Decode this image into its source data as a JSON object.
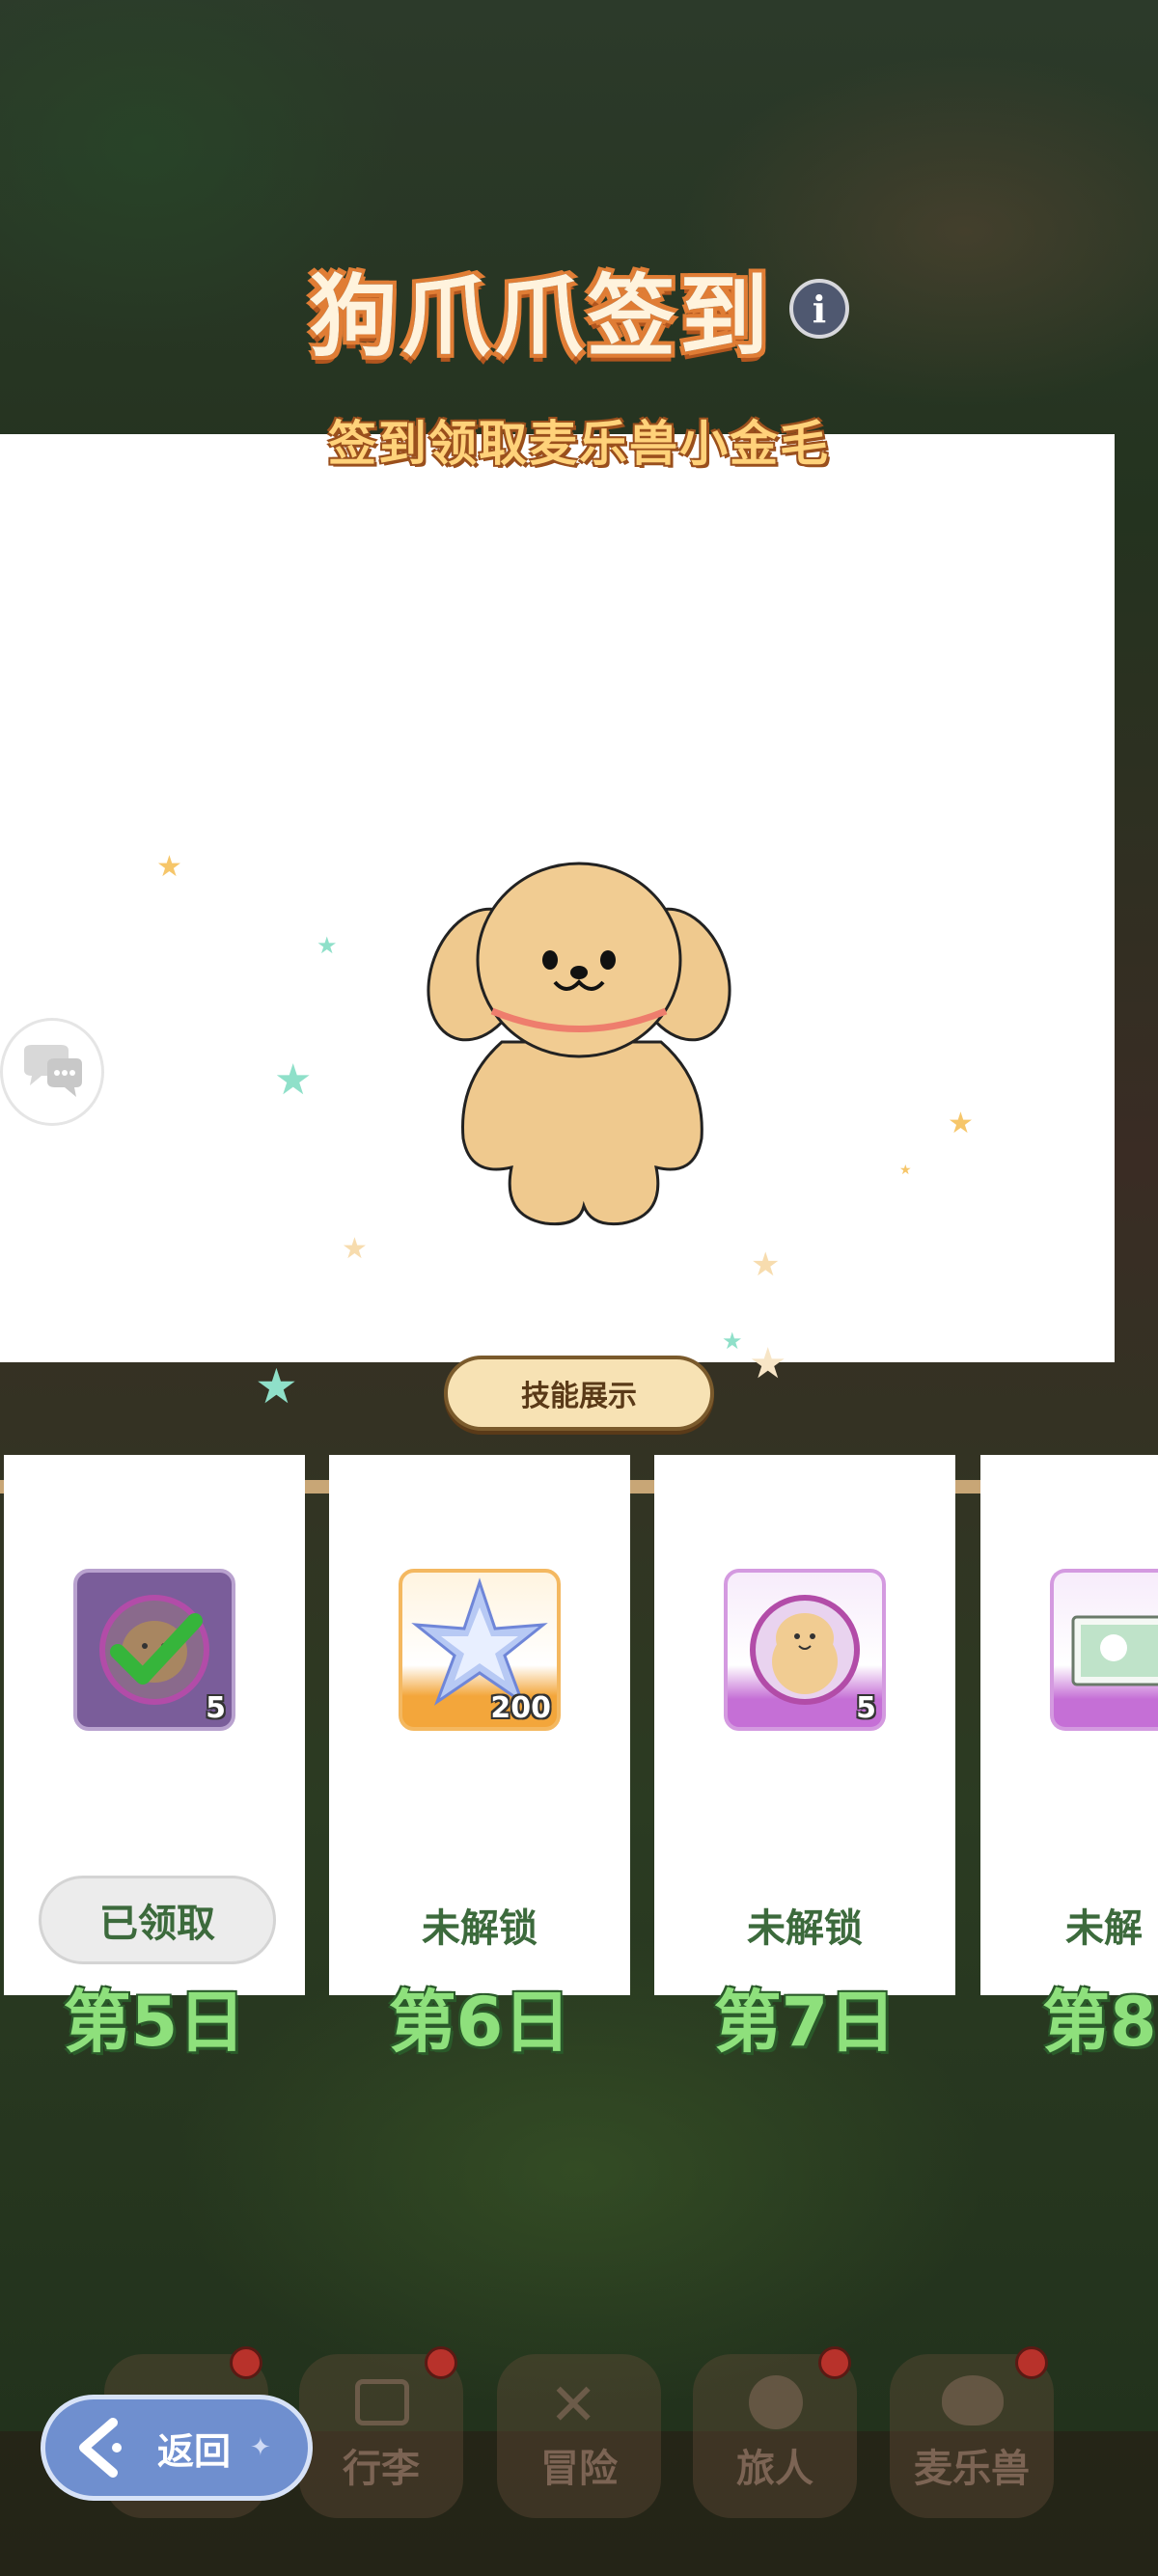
{
  "header": {
    "title": "狗爪爪签到",
    "info_icon": "i",
    "subtitle": "签到领取麦乐兽小金毛"
  },
  "preview": {
    "skill_button_label": "技能展示"
  },
  "cards": [
    {
      "day": "第5日",
      "status": "已领取",
      "claimed": true,
      "badge": "5",
      "reward_icon": "golden-puppy-icon"
    },
    {
      "day": "第6日",
      "status": "未解锁",
      "claimed": false,
      "badge": "200",
      "reward_icon": "star-crystal-icon"
    },
    {
      "day": "第7日",
      "status": "未解锁",
      "claimed": false,
      "badge": "5",
      "reward_icon": "golden-puppy-icon"
    },
    {
      "day": "第8",
      "status": "未解",
      "claimed": false,
      "badge": "",
      "reward_icon": "picture-card-icon"
    }
  ],
  "nav": {
    "back_label": "返回",
    "items": [
      {
        "label": "",
        "icon": "castle-icon",
        "dot": true
      },
      {
        "label": "行李",
        "icon": "chest-icon",
        "dot": true
      },
      {
        "label": "冒险",
        "icon": "crossed-swords-icon",
        "dot": false
      },
      {
        "label": "旅人",
        "icon": "character-icon",
        "dot": true
      },
      {
        "label": "麦乐兽",
        "icon": "pet-icon",
        "dot": true
      }
    ]
  },
  "colors": {
    "title_outline": "#e07d35",
    "day_text": "#8ee07c",
    "status_text": "#3c6a3c",
    "back_button": "#6f8fcf"
  }
}
